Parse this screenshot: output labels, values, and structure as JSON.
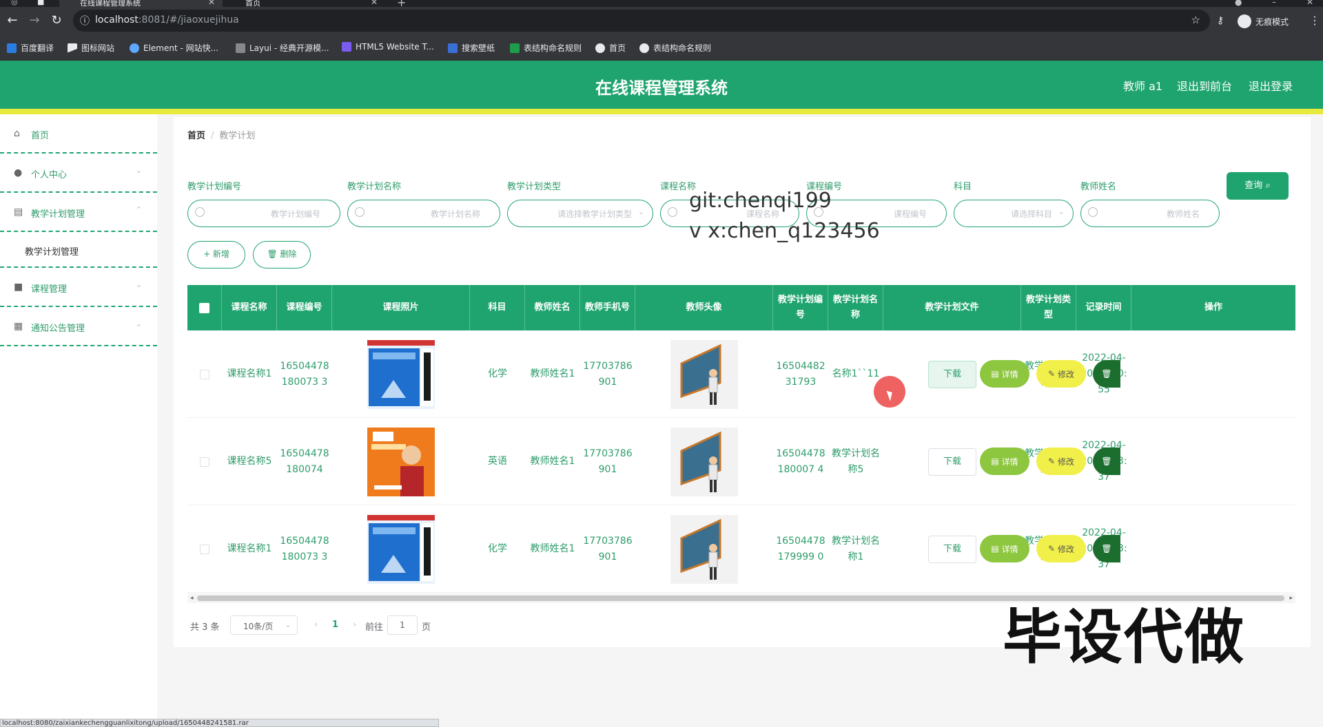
{
  "browser": {
    "tab1_title": "在线课程管理系统",
    "tab2_title": "首页",
    "url_host": "localhost",
    "url_rest": ":8081/#/jiaoxuejihua",
    "incognito_label": "无痕模式",
    "bookmarks": [
      "百度翻译",
      "图标网站",
      "Element - 网站快...",
      "Layui - 经典开源模...",
      "HTML5 Website T...",
      "搜索壁纸",
      "表结构命名规则",
      "首页",
      "表结构命名规则"
    ]
  },
  "header": {
    "title": "在线课程管理系统",
    "user": "教师 a1",
    "to_front": "退出到前台",
    "logout": "退出登录"
  },
  "sidebar": {
    "items": [
      {
        "label": "首页"
      },
      {
        "label": "个人中心"
      },
      {
        "label": "教学计划管理"
      },
      {
        "label": "教学计划管理"
      },
      {
        "label": "课程管理"
      },
      {
        "label": "通知公告管理"
      }
    ]
  },
  "breadcrumb": {
    "home": "首页",
    "current": "教学计划"
  },
  "filters": {
    "plan_no_label": "教学计划编号",
    "plan_no_ph": "教学计划编号",
    "plan_name_label": "教学计划名称",
    "plan_name_ph": "教学计划名称",
    "plan_type_label": "教学计划类型",
    "plan_type_ph": "请选择教学计划类型",
    "course_name_label": "课程名称",
    "course_name_ph": "课程名称",
    "course_no_label": "课程编号",
    "course_no_ph": "课程编号",
    "subject_label": "科目",
    "subject_ph": "请选择科目",
    "teacher_label": "教师姓名",
    "teacher_ph": "教师姓名",
    "search_btn": "查询"
  },
  "actions": {
    "add": "+ 新增",
    "delete": "删除"
  },
  "overlay": {
    "git": "git:chenqi199",
    "vx": "v x:chen_q123456",
    "banner": "毕设代做"
  },
  "table": {
    "headers": [
      "课程名称",
      "课程编号",
      "课程照片",
      "科目",
      "教师姓名",
      "教师手机号",
      "教师头像",
      "教学计划编号",
      "教学计划名称",
      "教学计划文件",
      "教学计划类型",
      "记录时间",
      "操作"
    ],
    "rows": [
      {
        "course_name": "课程名称1",
        "course_no": "16504478180073 3",
        "subject": "化学",
        "teacher": "教师姓名1",
        "phone": "17703786901",
        "plan_no": "1650448231793",
        "plan_name": "名称1``11",
        "file_btn": "下载",
        "plan_type": "教学计划类型4",
        "time": "2022-04-20 17:50:55"
      },
      {
        "course_name": "课程名称5",
        "course_no": "16504478180074",
        "subject": "英语",
        "teacher": "教师姓名1",
        "phone": "17703786901",
        "plan_no": "16504478180007 4",
        "plan_name": "教学计划名称5",
        "file_btn": "下载",
        "plan_type": "教学计划类型1",
        "time": "2022-04-20 17:43:37"
      },
      {
        "course_name": "课程名称1",
        "course_no": "16504478180073 3",
        "subject": "化学",
        "teacher": "教师姓名1",
        "phone": "17703786901",
        "plan_no": "16504478179999 0",
        "plan_name": "教学计划名称1",
        "file_btn": "下载",
        "plan_type": "教学计划类型3",
        "time": "2022-04-20 17:43:37"
      }
    ],
    "op_detail": "详情",
    "op_edit": "修改"
  },
  "pagination": {
    "total": "共 3 条",
    "page_size": "10条/页",
    "current": "1",
    "goto": "前往",
    "goto_value": "1",
    "page_unit": "页"
  },
  "status_url": "localhost:8080/zaixiankechengguanlixitong/upload/1650448241581.rar",
  "colors": {
    "primary": "#20a46f",
    "accent_stripe": "#e6ea3c"
  }
}
